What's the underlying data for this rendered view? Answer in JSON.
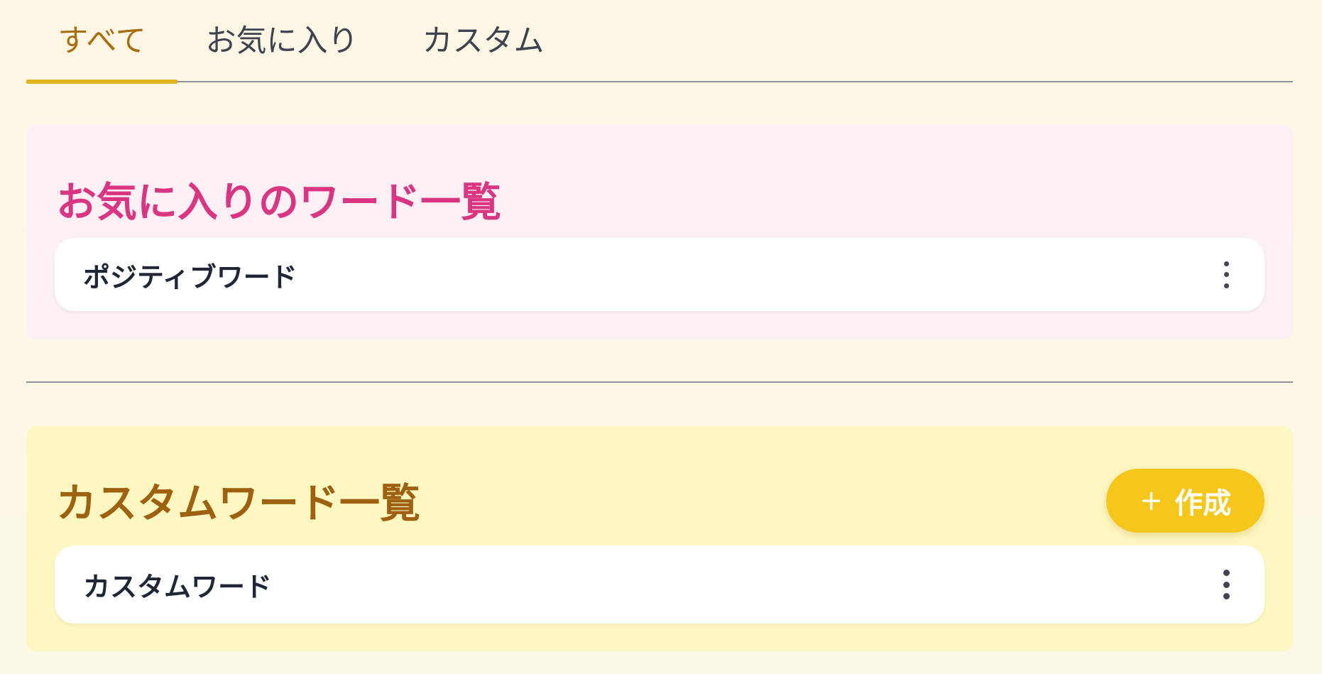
{
  "tabs": [
    {
      "label": "すべて",
      "active": true
    },
    {
      "label": "お気に入り",
      "active": false
    },
    {
      "label": "カスタム",
      "active": false
    }
  ],
  "favorites": {
    "title": "お気に入りのワード一覧",
    "items": [
      {
        "label": "ポジティブワード",
        "menu_icon": "more-vertical-icon"
      }
    ]
  },
  "custom": {
    "title": "カスタムワード一覧",
    "create_icon": "plus-icon",
    "create_label": "作成",
    "items": [
      {
        "label": "カスタムワード",
        "menu_icon": "more-vertical-icon"
      }
    ]
  },
  "colors": {
    "accent_tab": "#a86f10",
    "tab_indicator": "#e0b21f",
    "favorites_title": "#d93583",
    "custom_title": "#9e6110",
    "create_button": "#f5c71b",
    "favorites_bg": "#fcf0f5",
    "custom_bg": "#fdf7c2"
  }
}
